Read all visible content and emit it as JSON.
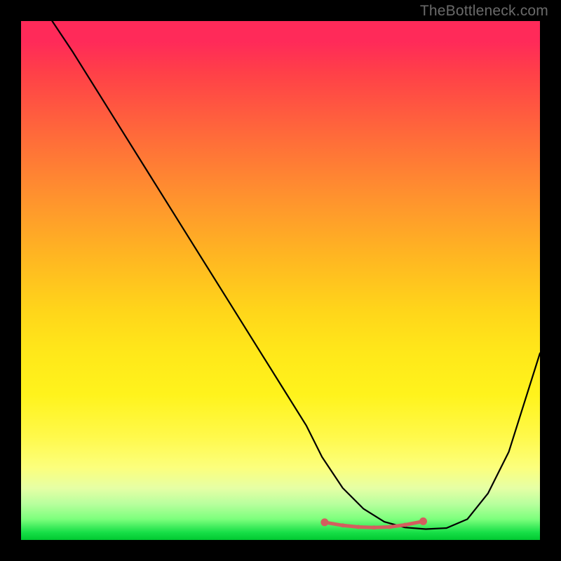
{
  "watermark": "TheBottleneck.com",
  "chart_data": {
    "type": "line",
    "title": "",
    "xlabel": "",
    "ylabel": "",
    "xlim": [
      0,
      100
    ],
    "ylim": [
      0,
      100
    ],
    "series": [
      {
        "name": "curve",
        "x": [
          6,
          10,
          15,
          20,
          25,
          30,
          35,
          40,
          45,
          50,
          55,
          58,
          62,
          66,
          70,
          74,
          78,
          82,
          86,
          90,
          94,
          100
        ],
        "y": [
          100,
          94,
          86,
          78,
          70,
          62,
          54,
          46,
          38,
          30,
          22,
          16,
          10,
          6,
          3.5,
          2.4,
          2.1,
          2.3,
          4,
          9,
          17,
          36
        ]
      }
    ],
    "markers": {
      "name": "bottom-markers",
      "color": "#d45e5e",
      "x": [
        58.5,
        62,
        65,
        68,
        71,
        74,
        77.5
      ],
      "y": [
        3.4,
        2.8,
        2.5,
        2.4,
        2.5,
        2.9,
        3.6
      ]
    },
    "gradient_stops": [
      {
        "pos": 0.0,
        "color": "#ff2a59"
      },
      {
        "pos": 0.5,
        "color": "#ffd61a"
      },
      {
        "pos": 0.86,
        "color": "#fcff7c"
      },
      {
        "pos": 1.0,
        "color": "#00c830"
      }
    ]
  }
}
